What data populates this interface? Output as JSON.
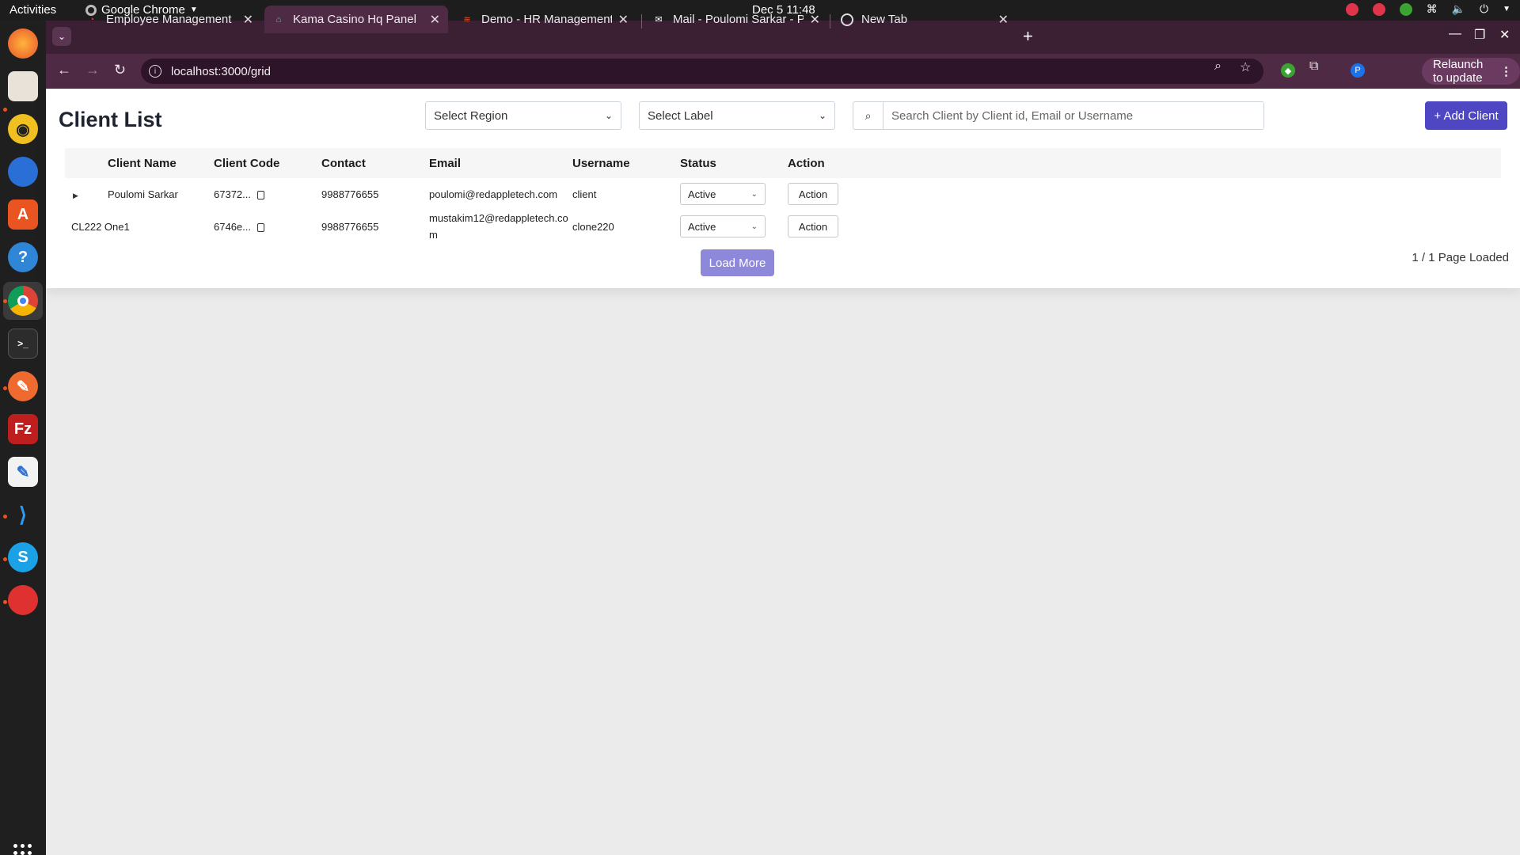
{
  "topbar": {
    "activities": "Activities",
    "app_name": "Google Chrome",
    "clock": "Dec 5  11:48"
  },
  "browser": {
    "tabs": [
      {
        "title": "Employee Management",
        "active": false
      },
      {
        "title": "Kama Casino Hq Panel",
        "active": true
      },
      {
        "title": "Demo - HR Management",
        "active": false
      },
      {
        "title": "Mail - Poulomi Sarkar - P",
        "active": false
      },
      {
        "title": "New Tab",
        "active": false
      }
    ],
    "url": "localhost:3000/grid",
    "profile_initial": "P",
    "relaunch_label": "Relaunch to update"
  },
  "page": {
    "title": "Client List",
    "region_select": "Select Region",
    "label_select": "Select Label",
    "search_placeholder": "Search Client by Client id, Email or Username",
    "add_client_label": "+ Add Client",
    "load_more_label": "Load More",
    "page_loaded_text": "1 / 1 Page Loaded"
  },
  "table": {
    "headers": [
      "Client Name",
      "Client Code",
      "Contact",
      "Email",
      "Username",
      "Status",
      "Action"
    ],
    "rows": [
      {
        "name": "Poulomi Sarkar",
        "code": "67372...",
        "contact": "9988776655",
        "email": "poulomi@redappletech.com",
        "username": "client",
        "status": "Active",
        "action": "Action"
      },
      {
        "name": "CL222 One1",
        "code": "6746e...",
        "contact": "9988776655",
        "email": "mustakim12@redappletech.com",
        "username": "clone220",
        "status": "Active",
        "action": "Action"
      }
    ]
  },
  "colors": {
    "accent": "#4e46c2",
    "load_more": "#8e88da",
    "chrome_frame": "#3b1f33",
    "chrome_toolbar": "#4e2a45"
  }
}
